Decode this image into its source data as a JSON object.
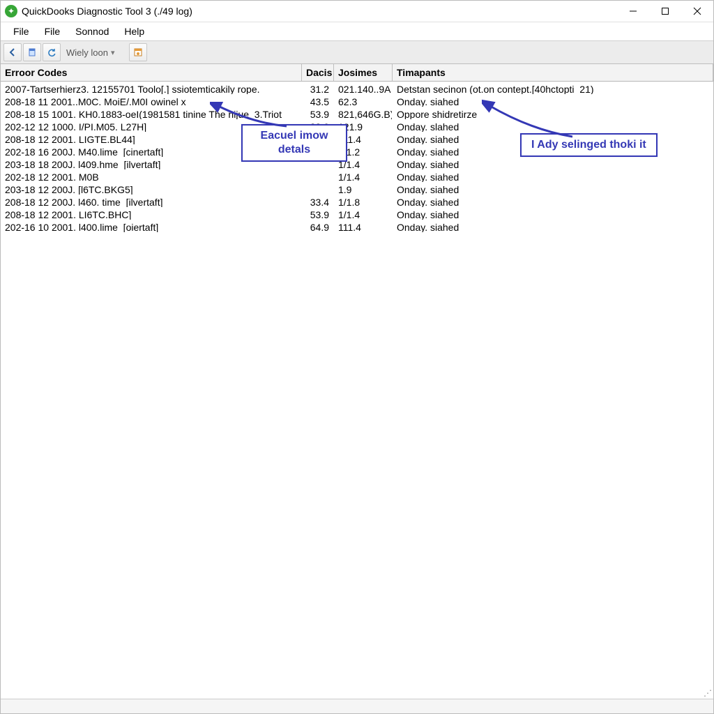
{
  "window": {
    "title": "QuickDooks Diagnostic Tool 3  (./49 log)"
  },
  "menu": {
    "items": [
      "File",
      "File",
      "Sonnod",
      "Help"
    ]
  },
  "toolbar": {
    "label": "Wiely  loon",
    "icon_labels": [
      "back-icon",
      "page-icon",
      "reload-icon"
    ]
  },
  "columns": {
    "error": "Erroor Codes",
    "dacis": "Dacis",
    "josimes": "Josimes",
    "timapants": "Timapants"
  },
  "rows": [
    {
      "error": "2007-Tartserhierz3. 12155701 Toolo[.]  ssiotemticakily rope.",
      "dacis": "31.2",
      "josimes": "021.140..9A",
      "timapants": "Detstan  secinon  (ot.on contept.[40hctopti_21)"
    },
    {
      "error": "208-18 11 2001..M0C. MoiE/.M0I  owinel x",
      "dacis": "43.5",
      "josimes": "62.3",
      "timapants": "Onday. siahed"
    },
    {
      "error": "208-18 15 1001. KH0.1883-oeI(1981581 tinine      The nijue_3.Triot",
      "dacis": "53.9",
      "josimes": "821,646G.B)",
      "timapants": "Oppore  shidretirze"
    },
    {
      "error": "202-12 12 1000. I/PI.M05. L27H]",
      "dacis": "33.9",
      "josimes": "121.9",
      "timapants": "Onday. slahed"
    },
    {
      "error": "208-18 12 2001. LIGTE.BL44]",
      "dacis": "",
      "josimes": "111.4",
      "timapants": "Onday. siahed"
    },
    {
      "error": "202-18 16 200J. M40.lime_[cinertaft]",
      "dacis": "",
      "josimes": "1/1.2",
      "timapants": "Onday. siahed"
    },
    {
      "error": "203-18 18 200J. l409.hme_[ilvertaft]",
      "dacis": "",
      "josimes": "1/1.4",
      "timapants": "Onday. siahed"
    },
    {
      "error": "202-18 12 2001. M0B",
      "dacis": "",
      "josimes": "1/1.4",
      "timapants": "Onday. siahed"
    },
    {
      "error": "203-18 12 200J. [l6TC.BKG5]",
      "dacis": "",
      "josimes": "1.9",
      "timapants": "Onday. siahed"
    },
    {
      "error": "208-18 12 200J. l460. time_[ilvertaft]",
      "dacis": "33.4",
      "josimes": "1/1.8",
      "timapants": "Onday. siahed"
    },
    {
      "error": "208-18 12 2001. LI6TC.BHC]",
      "dacis": "53.9",
      "josimes": "1/1.4",
      "timapants": "Onday. siahed"
    },
    {
      "error": "202-16 10 2001. l400.lime_[oiertaft]",
      "dacis": "64.9",
      "josimes": "111.4",
      "timapants": "Onday. siahed"
    }
  ],
  "annotations": {
    "callout1": "Eacuel imow\ndetals",
    "callout2": "I Ady selinged thoki it"
  },
  "status": {
    "left": "",
    "right": ""
  }
}
